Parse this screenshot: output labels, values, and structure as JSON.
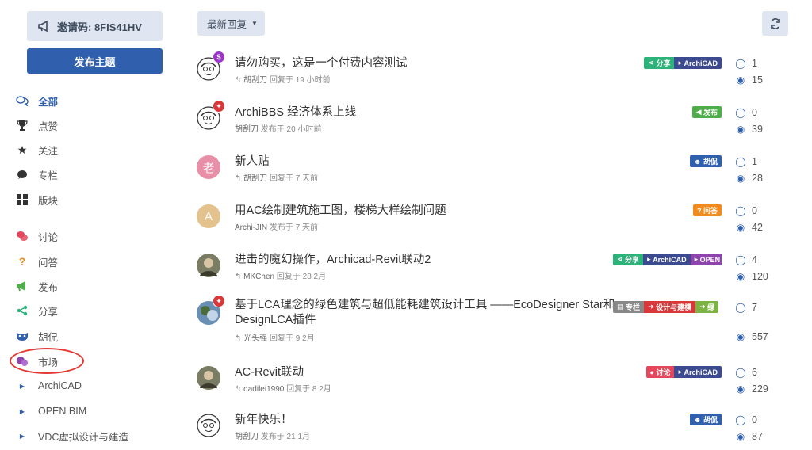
{
  "sidebar": {
    "invite": "邀请码: 8FIS41HV",
    "new_topic": "发布主题",
    "nav": [
      {
        "label": "全部",
        "icon": "chat-bubbles-icon",
        "active": true
      },
      {
        "label": "点赞",
        "icon": "trophy-icon"
      },
      {
        "label": "关注",
        "icon": "star-icon"
      },
      {
        "label": "专栏",
        "icon": "speech-bubble-icon"
      },
      {
        "label": "版块",
        "icon": "grid-icon"
      }
    ],
    "categories": [
      {
        "label": "讨论",
        "icon": "discuss-icon",
        "color": "#e5465b"
      },
      {
        "label": "问答",
        "icon": "question-icon",
        "color": "#f28b1e"
      },
      {
        "label": "发布",
        "icon": "megaphone-icon",
        "color": "#4fae4a"
      },
      {
        "label": "分享",
        "icon": "share-icon",
        "color": "#2bb37a"
      },
      {
        "label": "胡侃",
        "icon": "mask-icon",
        "color": "#2f5fad"
      },
      {
        "label": "市场",
        "icon": "market-icon",
        "color": "#8e44ad"
      }
    ],
    "sub": [
      {
        "label": "ArchiCAD"
      },
      {
        "label": "OPEN BIM"
      },
      {
        "label": "VDC虚拟设计与建造"
      }
    ]
  },
  "toolbar": {
    "sort_label": "最新回复"
  },
  "topics": [
    {
      "title": "请勿购买，这是一个付费内容测试",
      "meta_user": "胡刮刀",
      "meta_text": "回复于 19 小时前",
      "reply_icon": true,
      "tags": [
        {
          "text": "分享",
          "color": "#2bb37a",
          "icon": "share-icon"
        },
        {
          "text": "ArchiCAD",
          "color": "#3c4a8f",
          "icon": "triangle-icon"
        }
      ],
      "replies": "1",
      "views": "15",
      "badge": "$",
      "badge_color": "#9b36c9"
    },
    {
      "title": "ArchiBBS 经济体系上线",
      "meta_user": "胡刮刀",
      "meta_text": "发布于 20 小时前",
      "reply_icon": false,
      "tags": [
        {
          "text": "发布",
          "color": "#4fae4a",
          "icon": "megaphone-icon"
        }
      ],
      "replies": "0",
      "views": "39",
      "badge": "pin",
      "badge_color": "#d9383a"
    },
    {
      "title": "新人贴",
      "meta_user": "胡刮刀",
      "meta_text": "回复于 7 天前",
      "reply_icon": true,
      "tags": [
        {
          "text": "胡侃",
          "color": "#2f5fad",
          "icon": "mask-icon"
        }
      ],
      "replies": "1",
      "views": "28",
      "avatar_letter": "老",
      "avatar_color": "#e98ea7"
    },
    {
      "title": "用AC绘制建筑施工图，楼梯大样绘制问题",
      "meta_user": "Archi-JIN",
      "meta_text": "发布于 7 天前",
      "reply_icon": false,
      "tags": [
        {
          "text": "问答",
          "color": "#f28b1e",
          "icon": "question-icon"
        }
      ],
      "replies": "0",
      "views": "42",
      "avatar_letter": "A",
      "avatar_color": "#e3c28e"
    },
    {
      "title": "进击的魔幻操作，Archicad-Revit联动2",
      "meta_user": "MKChen",
      "meta_text": "回复于 28 2月",
      "reply_icon": true,
      "tags": [
        {
          "text": "分享",
          "color": "#2bb37a",
          "icon": "share-icon"
        },
        {
          "text": "ArchiCAD",
          "color": "#3c4a8f",
          "icon": "triangle-icon"
        },
        {
          "text": "OPEN",
          "color": "#8e44ad",
          "icon": "triangle-icon"
        }
      ],
      "replies": "4",
      "views": "120"
    },
    {
      "title": "基于LCA理念的绿色建筑与超低能耗建筑设计工具 ——EcoDesigner Star和DesignLCA插件",
      "meta_user": "光头强",
      "meta_text": "回复于 9 2月",
      "reply_icon": true,
      "tags": [
        {
          "text": "专栏",
          "color": "#888888",
          "icon": "column-icon"
        },
        {
          "text": "设计与建模",
          "color": "#d9383a",
          "icon": "arrow-icon"
        },
        {
          "text": "绿",
          "color": "#7cb342",
          "icon": "arrow-icon"
        }
      ],
      "replies": "7",
      "views": "557",
      "badge": "pin",
      "badge_color": "#d9383a"
    },
    {
      "title": "AC-Revit联动",
      "meta_user": "dadilei1990",
      "meta_text": "回复于 8 2月",
      "reply_icon": true,
      "tags": [
        {
          "text": "讨论",
          "color": "#e5465b",
          "icon": "discuss-icon"
        },
        {
          "text": "ArchiCAD",
          "color": "#3c4a8f",
          "icon": "triangle-icon"
        }
      ],
      "replies": "6",
      "views": "229"
    },
    {
      "title": "新年快乐！",
      "meta_user": "胡刮刀",
      "meta_text": "发布于 21 1月",
      "reply_icon": false,
      "tags": [
        {
          "text": "胡侃",
          "color": "#2f5fad",
          "icon": "mask-icon"
        }
      ],
      "replies": "0",
      "views": "87"
    }
  ]
}
